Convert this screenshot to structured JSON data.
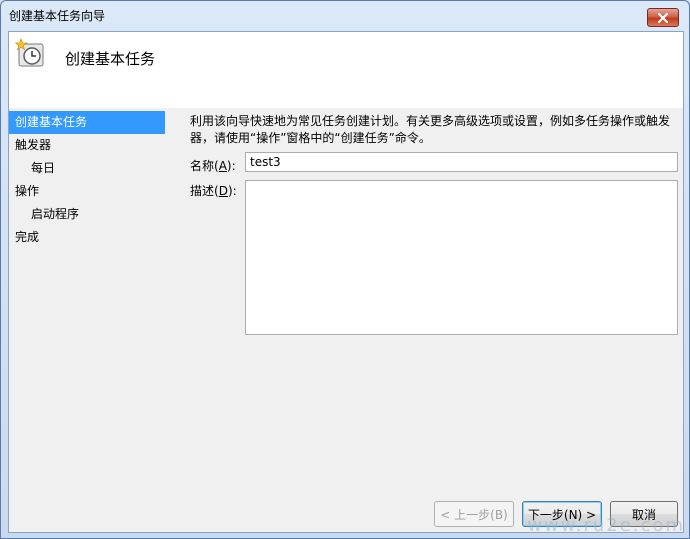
{
  "window": {
    "title": "创建基本任务向导"
  },
  "header": {
    "title": "创建基本任务"
  },
  "sidebar": {
    "items": [
      {
        "label": "创建基本任务",
        "selected": true
      },
      {
        "label": "触发器"
      },
      {
        "label": "每日",
        "sub": true
      },
      {
        "label": "操作"
      },
      {
        "label": "启动程序",
        "sub": true
      },
      {
        "label": "完成"
      }
    ]
  },
  "content": {
    "description": "利用该向导快速地为常见任务创建计划。有关更多高级选项或设置，例如多任务操作或触发器，请使用“操作”窗格中的“创建任务”命令。",
    "name_label_pre": "名称(",
    "name_label_key": "A",
    "name_label_post": "):",
    "name_value": "test3",
    "desc_label_pre": "描述(",
    "desc_label_key": "D",
    "desc_label_post": "):"
  },
  "buttons": {
    "back": "< 上一步(B)",
    "next": "下一步(N) >",
    "cancel": "取消"
  },
  "watermark": "www.ru2e.com",
  "colors": {
    "selection": "#3399ff",
    "close_button": "#c2391f"
  }
}
